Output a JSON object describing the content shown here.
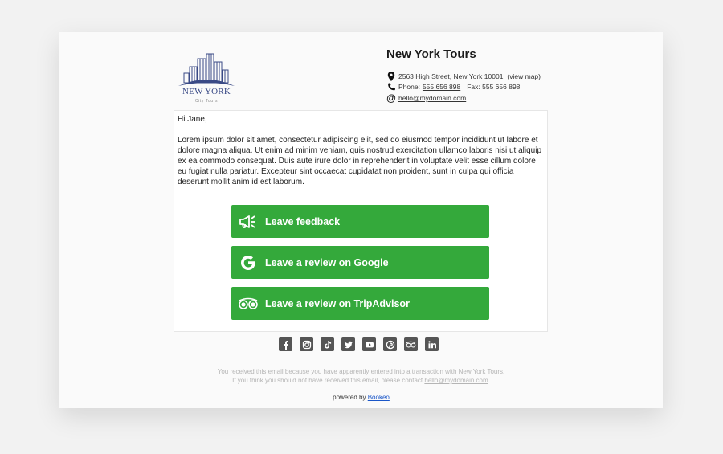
{
  "brand": {
    "logo_name": "NEW YORK",
    "logo_sub": "City Tours",
    "brand_color": "#3a4a86"
  },
  "company": {
    "name": "New York Tours",
    "address": "2563 High Street, New York 10001",
    "view_map": "(view map)",
    "phone_label": "Phone:",
    "phone": "555 656 898",
    "fax": "Fax: 555 656 898",
    "email": "hello@mydomain.com"
  },
  "message": {
    "greeting": "Hi Jane,",
    "body": "Lorem ipsum dolor sit amet, consectetur adipiscing elit, sed do eiusmod tempor incididunt ut labore et dolore magna aliqua. Ut enim ad minim veniam, quis nostrud exercitation ullamco laboris nisi ut aliquip ex ea commodo consequat. Duis aute irure dolor in reprehenderit in voluptate velit esse cillum dolore eu fugiat nulla pariatur. Excepteur sint occaecat cupidatat non proident, sunt in culpa qui officia deserunt mollit anim id est laborum."
  },
  "buttons": {
    "feedback": "Leave feedback",
    "google": "Leave a review on Google",
    "tripadvisor": "Leave a review on TripAdvisor",
    "color": "#34a93b"
  },
  "social_icons": [
    "facebook-icon",
    "instagram-icon",
    "tiktok-icon",
    "twitter-icon",
    "youtube-icon",
    "pinterest-icon",
    "tripadvisor-icon",
    "linkedin-icon"
  ],
  "footer": {
    "line1": "You received this email because you have apparently entered into a transaction with New York Tours.",
    "line2_prefix": "If you think you should not have received this email, please contact",
    "line2_email": "hello@mydomain.com",
    "line2_suffix": ".",
    "powered_prefix": "powered by",
    "powered_link": "Bookeo"
  }
}
